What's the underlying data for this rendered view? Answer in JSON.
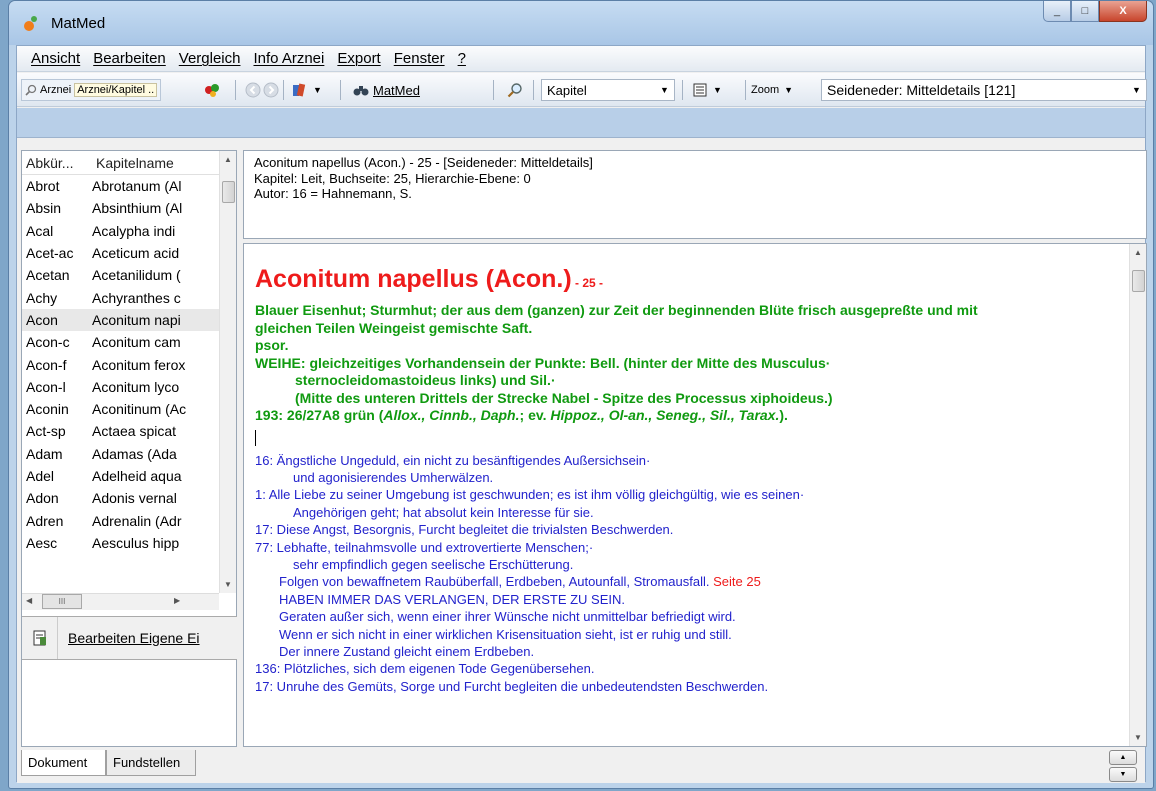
{
  "window": {
    "title": "MatMed",
    "controls": {
      "minimize": "_",
      "maximize": "□",
      "close": "X"
    }
  },
  "menu": [
    "Ansicht",
    "Bearbeiten",
    "Vergleich",
    "Info Arznei",
    "Export",
    "Fenster",
    "?"
  ],
  "toolbar": {
    "arznei_label": "Arznei",
    "arznei_combo": "Arznei/Kapitel ..",
    "matmed_label": "MatMed",
    "kapitel_combo": "Kapitel",
    "zoom_label": "Zoom",
    "source_combo": "Seideneder: Mitteldetails [121]"
  },
  "list": {
    "headers": [
      "Abkür...",
      "Kapitelname"
    ],
    "rows": [
      {
        "abbr": "Abrot",
        "name": "Abrotanum (Al"
      },
      {
        "abbr": "Absin",
        "name": "Absinthium (Al"
      },
      {
        "abbr": "Acal",
        "name": "Acalypha indi"
      },
      {
        "abbr": "Acet-ac",
        "name": "Aceticum acid"
      },
      {
        "abbr": "Acetan",
        "name": "Acetanilidum ("
      },
      {
        "abbr": "Achy",
        "name": "Achyranthes c"
      },
      {
        "abbr": "Acon",
        "name": "Aconitum napi",
        "selected": true
      },
      {
        "abbr": "Acon-c",
        "name": "Aconitum cam"
      },
      {
        "abbr": "Acon-f",
        "name": "Aconitum ferox"
      },
      {
        "abbr": "Acon-l",
        "name": "Aconitum lyco"
      },
      {
        "abbr": "Aconin",
        "name": "Aconitinum (Ac"
      },
      {
        "abbr": "Act-sp",
        "name": "Actaea spicat"
      },
      {
        "abbr": "Adam",
        "name": "Adamas (Ada"
      },
      {
        "abbr": "Adel",
        "name": "Adelheid aqua"
      },
      {
        "abbr": "Adon",
        "name": "Adonis vernal"
      },
      {
        "abbr": "Adren",
        "name": "Adrenalin (Adr"
      },
      {
        "abbr": "Aesc",
        "name": "Aesculus hipp"
      }
    ],
    "hscroll_thumb": "III"
  },
  "edit_panel": {
    "label": "Bearbeiten Eigene Ei"
  },
  "info": {
    "line1": "Aconitum napellus (Acon.) - 25 - [Seideneder: Mitteldetails]",
    "line2": "Kapitel: Leit, Buchseite: 25, Hierarchie-Ebene: 0",
    "line3": "Autor: 16 = Hahnemann, S."
  },
  "doc": {
    "title": "Aconitum napellus (Acon.)",
    "title_page": " - 25 -",
    "green1": "Blauer Eisenhut; Sturmhut; der aus dem (ganzen) zur Zeit der beginnenden Blüte frisch ausgepreßte und mit",
    "green2": "gleichen Teilen Weingeist gemischte Saft.",
    "green3": "psor.",
    "green4": "WEIHE: gleichzeitiges Vorhandensein der Punkte: Bell. (hinter der Mitte des Musculus·",
    "green5": "sternocleidomastoideus links) und Sil.·",
    "green6": "(Mitte des unteren Drittels der Strecke Nabel - Spitze des Processus xiphoideus.)",
    "green7_a": "193: 26/27A8 grün (",
    "green7_b": "Allox., Cinnb., Daph.",
    "green7_c": "; ev. ",
    "green7_d": "Hippoz., Ol-an., Seneg., Sil., Tarax.",
    "green7_e": ").",
    "blue": [
      "16: Ängstliche Ungeduld, ein nicht zu besänftigendes Außersichsein·",
      "und agonisierendes Umherwälzen.",
      "1:   Alle Liebe zu seiner Umgebung ist geschwunden; es ist ihm völlig gleichgültig, wie es seinen·",
      "Angehörigen geht; hat absolut kein Interesse für sie.",
      "17: Diese Angst, Besorgnis, Furcht begleitet die trivialsten Beschwerden.",
      "77: Lebhafte, teilnahmsvolle und extrovertierte Menschen;·",
      "sehr empfindlich gegen seelische Erschütterung.",
      "Folgen von bewaffnetem Raubüberfall, Erdbeben, Autounfall, Stromausfall.",
      "HABEN IMMER DAS VERLANGEN, DER ERSTE ZU SEIN.",
      "Geraten außer sich, wenn einer ihrer Wünsche nicht unmittelbar befriedigt wird.",
      "Wenn er sich nicht in einer wirklichen Krisensituation sieht, ist er ruhig und still.",
      "Der innere Zustand gleicht einem Erdbeben.",
      "136: Plötzliches, sich dem eigenen Tode Gegenübersehen.",
      "17: Unruhe des Gemüts, Sorge und Furcht begleiten die unbedeutendsten Beschwerden."
    ],
    "seite_ref": " Seite 25"
  },
  "tabs": [
    "Dokument",
    "Fundstellen"
  ]
}
